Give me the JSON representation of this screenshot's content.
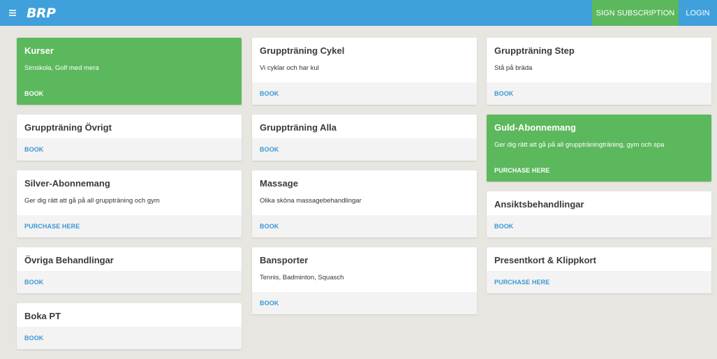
{
  "header": {
    "logo": "BRP",
    "sign_subscription": "SIGN SUBSCRIPTION",
    "login": "LOGIN"
  },
  "columns": [
    [
      {
        "title": "Kurser",
        "desc": "Simskola, Golf med mera",
        "action": "BOOK",
        "green": true
      },
      {
        "title": "Gruppträning Övrigt",
        "desc": "",
        "action": "BOOK",
        "green": false
      },
      {
        "title": "Silver-Abonnemang",
        "desc": "Ger dig rätt att gå på all gruppträning och gym",
        "action": "PURCHASE HERE",
        "green": false
      },
      {
        "title": "Övriga Behandlingar",
        "desc": "",
        "action": "BOOK",
        "green": false
      },
      {
        "title": "Boka PT",
        "desc": "",
        "action": "BOOK",
        "green": false
      }
    ],
    [
      {
        "title": "Gruppträning Cykel",
        "desc": "Vi cyklar och har kul",
        "action": "BOOK",
        "green": false
      },
      {
        "title": "Gruppträning Alla",
        "desc": "",
        "action": "BOOK",
        "green": false
      },
      {
        "title": "Massage",
        "desc": "Olika sköna massagebehandlingar",
        "action": "BOOK",
        "green": false
      },
      {
        "title": "Bansporter",
        "desc": "Tennis, Badminton, Squasch",
        "action": "BOOK",
        "green": false
      }
    ],
    [
      {
        "title": "Gruppträning Step",
        "desc": "Stå på bräda",
        "action": "BOOK",
        "green": false
      },
      {
        "title": "Guld-Abonnemang",
        "desc": "Ger dig rätt att gå på all gruppträningträning, gym och spa",
        "action": "PURCHASE HERE",
        "green": true
      },
      {
        "title": "Ansiktsbehandlingar",
        "desc": "",
        "action": "BOOK",
        "green": false
      },
      {
        "title": "Presentkort & Klippkort",
        "desc": "",
        "action": "PURCHASE HERE",
        "green": false
      }
    ]
  ],
  "colors": {
    "topbar": "#3fa0dc",
    "green": "#5cb85c",
    "link": "#3a97d4",
    "background": "#e8e6e1"
  }
}
